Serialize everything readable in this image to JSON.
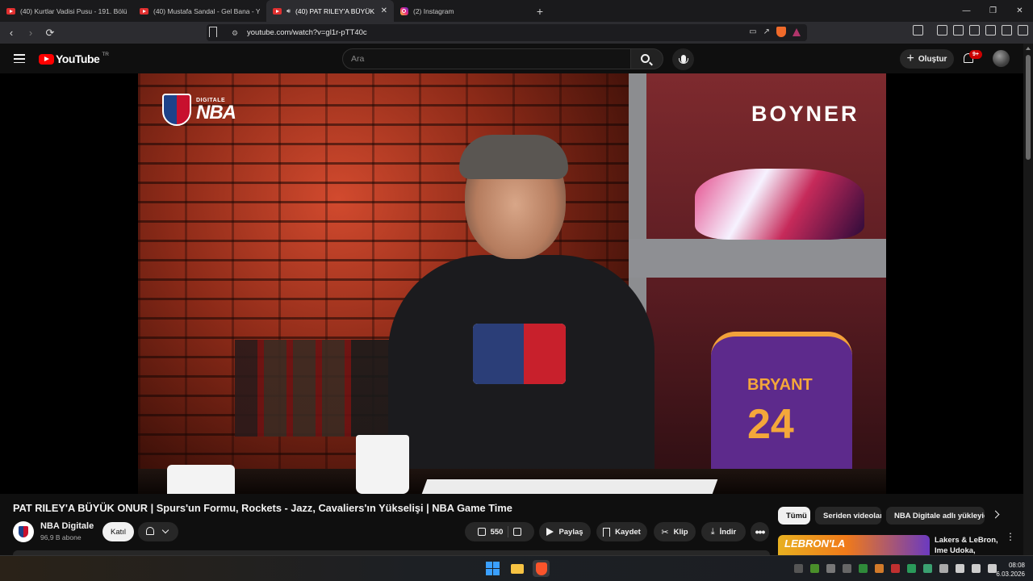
{
  "browser": {
    "tabs": [
      {
        "title": "(40) Kurtlar Vadisi Pusu - 191. Bölüm",
        "icon": "youtube-icon",
        "active": false
      },
      {
        "title": "(40) Mustafa Sandal - Gel Bana - You",
        "icon": "youtube-icon",
        "active": false
      },
      {
        "title": "(40) PAT RILEY'A BÜYÜK ONUR",
        "icon": "youtube-icon",
        "active": true
      },
      {
        "title": "(2) Instagram",
        "icon": "instagram-icon",
        "active": false
      }
    ],
    "new_tab": "+",
    "window_controls": [
      "—",
      "❐",
      "✕"
    ],
    "url": "youtube.com/watch?v=gl1r-pTT40c"
  },
  "youtube": {
    "logo_text": "YouTube",
    "country_code": "TR",
    "search_placeholder": "Ara",
    "create_label": "Oluştur",
    "notifications_badge": "9+"
  },
  "video": {
    "overlay_brand": "NBA",
    "overlay_brand_small": "DIGITALE",
    "sponsor": "BOYNER",
    "jersey_name": "BRYANT",
    "jersey_number": "24",
    "title": "PAT RILEY'A BÜYÜK ONUR | Spurs'un Formu, Rockets - Jazz, Cavaliers'ın Yükselişi | NBA Game Time"
  },
  "channel": {
    "name": "NBA Digitale",
    "subscribers": "96,9 B abone",
    "join_label": "Katıl"
  },
  "actions": {
    "likes": "550",
    "share": "Paylaş",
    "save": "Kaydet",
    "clip": "Klip",
    "download": "İndir",
    "more": "•••"
  },
  "sidebar": {
    "chips": [
      "Tümü",
      "Seriden videolar",
      "NBA Digitale adlı yükleyici"
    ],
    "recommendation": {
      "thumb_text": "LEBRON'LA",
      "title": "Lakers & LeBron, Ime Udoka, Hard..."
    }
  },
  "taskbar": {
    "time": "08:08",
    "date": "6.03.2026"
  },
  "colors": {
    "youtube_red": "#ff0000",
    "background": "#0f0f0f",
    "chip_active": "#f1f1f1"
  }
}
